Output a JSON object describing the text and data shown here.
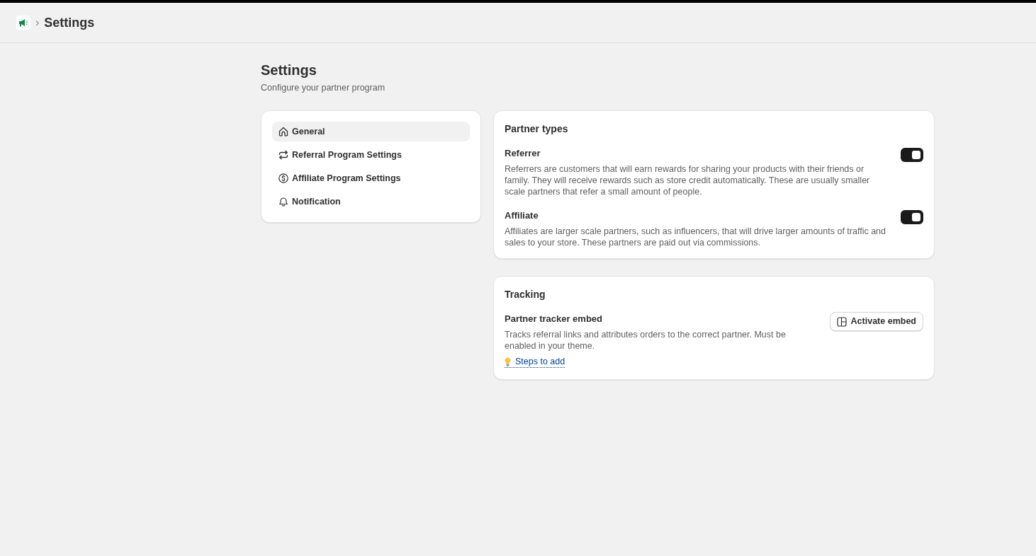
{
  "breadcrumb": {
    "separator": "›",
    "current": "Settings"
  },
  "page": {
    "title": "Settings",
    "subtitle": "Configure your partner program"
  },
  "nav": {
    "items": [
      {
        "label": "General",
        "selected": true
      },
      {
        "label": "Referral Program Settings",
        "selected": false
      },
      {
        "label": "Affiliate Program Settings",
        "selected": false
      },
      {
        "label": "Notification",
        "selected": false
      }
    ]
  },
  "partner_types": {
    "title": "Partner types",
    "items": [
      {
        "name": "Referrer",
        "description": "Referrers are customers that will earn rewards for sharing your products with their friends or family. They will receive rewards such as store credit automatically. These are usually smaller scale partners that refer a small amount of people.",
        "on": true
      },
      {
        "name": "Affiliate",
        "description": "Affiliates are larger scale partners, such as influencers, that will drive larger amounts of traffic and sales to your store. These partners are paid out via commissions.",
        "on": true
      }
    ]
  },
  "tracking": {
    "title": "Tracking",
    "items": [
      {
        "name": "Partner tracker embed",
        "description": "Tracks referral links and attributes orders to the correct partner. Must be enabled in your theme.",
        "link": "Steps to add",
        "button": "Activate embed"
      }
    ]
  }
}
